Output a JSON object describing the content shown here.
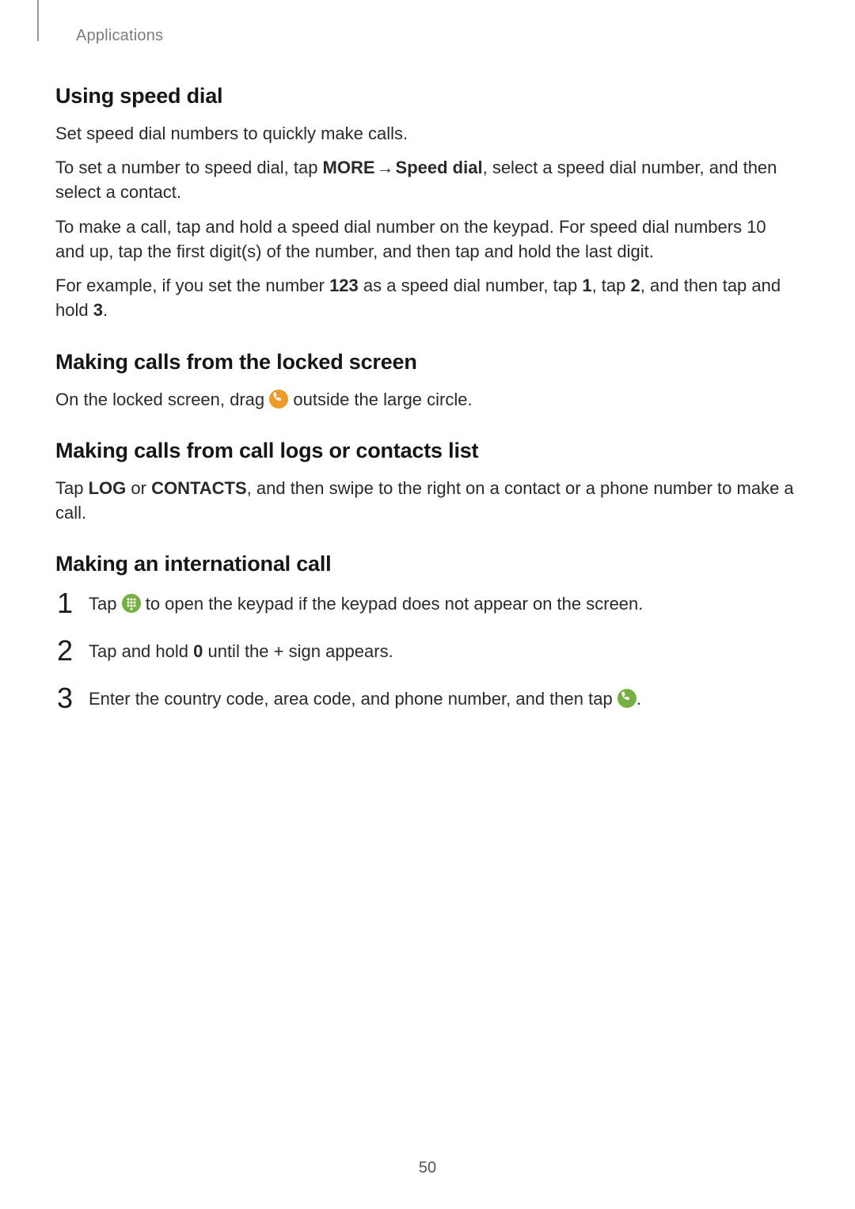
{
  "crumb": "Applications",
  "s1": {
    "title": "Using speed dial",
    "p1": "Set speed dial numbers to quickly make calls.",
    "p2a": "To set a number to speed dial, tap ",
    "p2_more": "MORE",
    "p2_arrow": " → ",
    "p2_sd": "Speed dial",
    "p2b": ", select a speed dial number, and then select a contact.",
    "p3": "To make a call, tap and hold a speed dial number on the keypad. For speed dial numbers 10 and up, tap the first digit(s) of the number, and then tap and hold the last digit.",
    "p4a": "For example, if you set the number ",
    "p4_123": "123",
    "p4b": " as a speed dial number, tap ",
    "p4_1": "1",
    "p4c": ", tap ",
    "p4_2": "2",
    "p4d": ", and then tap and hold ",
    "p4_3": "3",
    "p4e": "."
  },
  "s2": {
    "title": "Making calls from the locked screen",
    "p1a": "On the locked screen, drag ",
    "p1b": " outside the large circle."
  },
  "s3": {
    "title": "Making calls from call logs or contacts list",
    "p1a": "Tap ",
    "p1_log": "LOG",
    "p1b": " or ",
    "p1_contacts": "CONTACTS",
    "p1c": ", and then swipe to the right on a contact or a phone number to make a call."
  },
  "s4": {
    "title": "Making an international call",
    "step1a": "Tap ",
    "step1b": " to open the keypad if the keypad does not appear on the screen.",
    "step2a": "Tap and hold ",
    "step2_0": "0",
    "step2b": " until the ",
    "step2_plus": "+",
    "step2c": " sign appears.",
    "step3a": "Enter the country code, area code, and phone number, and then tap ",
    "step3b": ".",
    "n1": "1",
    "n2": "2",
    "n3": "3"
  },
  "page": "50"
}
